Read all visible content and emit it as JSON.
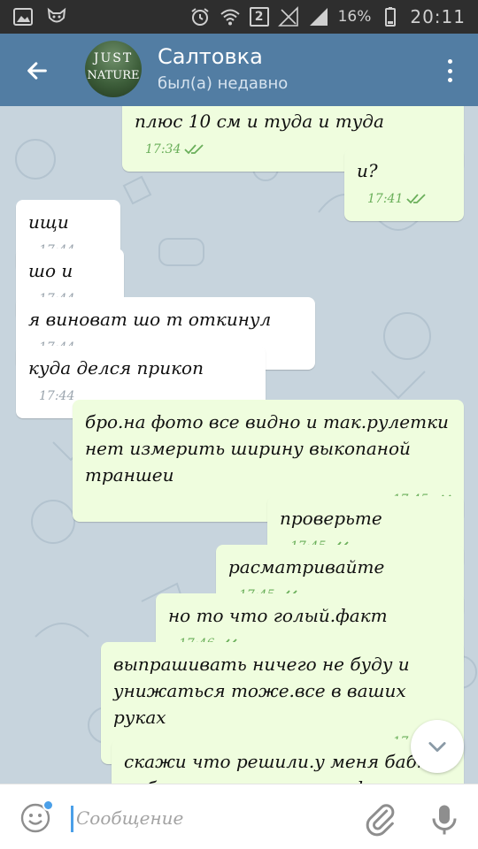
{
  "status_bar": {
    "battery": "16%",
    "time": "20:11",
    "sim": "2",
    "icons": [
      "gallery-icon",
      "fox-app-icon",
      "alarm-icon",
      "wifi-icon",
      "sim-2-icon",
      "signal-no-service-icon",
      "signal-icon",
      "battery-icon"
    ]
  },
  "header": {
    "title": "Салтовка",
    "status": "был(а) недавно",
    "avatar_line1": "JUST",
    "avatar_line2": "NATURE",
    "icons": [
      "back-arrow-icon",
      "more-vertical-icon"
    ]
  },
  "messages": [
    {
      "dir": "out",
      "text": "плюс 10 см и туда и туда",
      "time": "17:34",
      "read": true
    },
    {
      "dir": "out",
      "text": "и?",
      "time": "17:41",
      "read": true
    },
    {
      "dir": "in",
      "text": "ищи",
      "time": "17:44"
    },
    {
      "dir": "in",
      "text": "шо и",
      "time": "17:44"
    },
    {
      "dir": "in",
      "text": "я виноват шо т откинул",
      "time": "17:44"
    },
    {
      "dir": "in",
      "text": "куда делся прикоп",
      "time": "17:44"
    },
    {
      "dir": "out",
      "text": "бро.на фото все видно и так.рулетки нет измерить ширину выкопаной траншеи",
      "time": "17:45",
      "read": true
    },
    {
      "dir": "out",
      "text": "проверьте",
      "time": "17:45",
      "read": true
    },
    {
      "dir": "out",
      "text": "расматривайте",
      "time": "17:45",
      "read": true
    },
    {
      "dir": "out",
      "text": "но то что голый.факт",
      "time": "17:46",
      "read": true
    },
    {
      "dir": "out",
      "text": "выпрашивать ничего не буду и унижаться тоже.все в ваших руках",
      "time": "17:46",
      "read": true
    },
    {
      "dir": "out",
      "text": "скажи что решили.у меня бабк небо не поплыт т м по фото все",
      "time": "",
      "read": false
    }
  ],
  "composer": {
    "placeholder": "Сообщение",
    "icons": [
      "emoji-icon",
      "attach-icon",
      "mic-icon"
    ]
  },
  "scroll_down": {
    "icon": "chevron-down-icon"
  },
  "colors": {
    "header": "#527da3",
    "status_bar": "#2e2e2e",
    "bubble_out": "#effdde",
    "bubble_in": "#ffffff",
    "checks": "#6aaf5a",
    "wallpaper": "#c7d4dd",
    "accent": "#4a9fe8"
  }
}
